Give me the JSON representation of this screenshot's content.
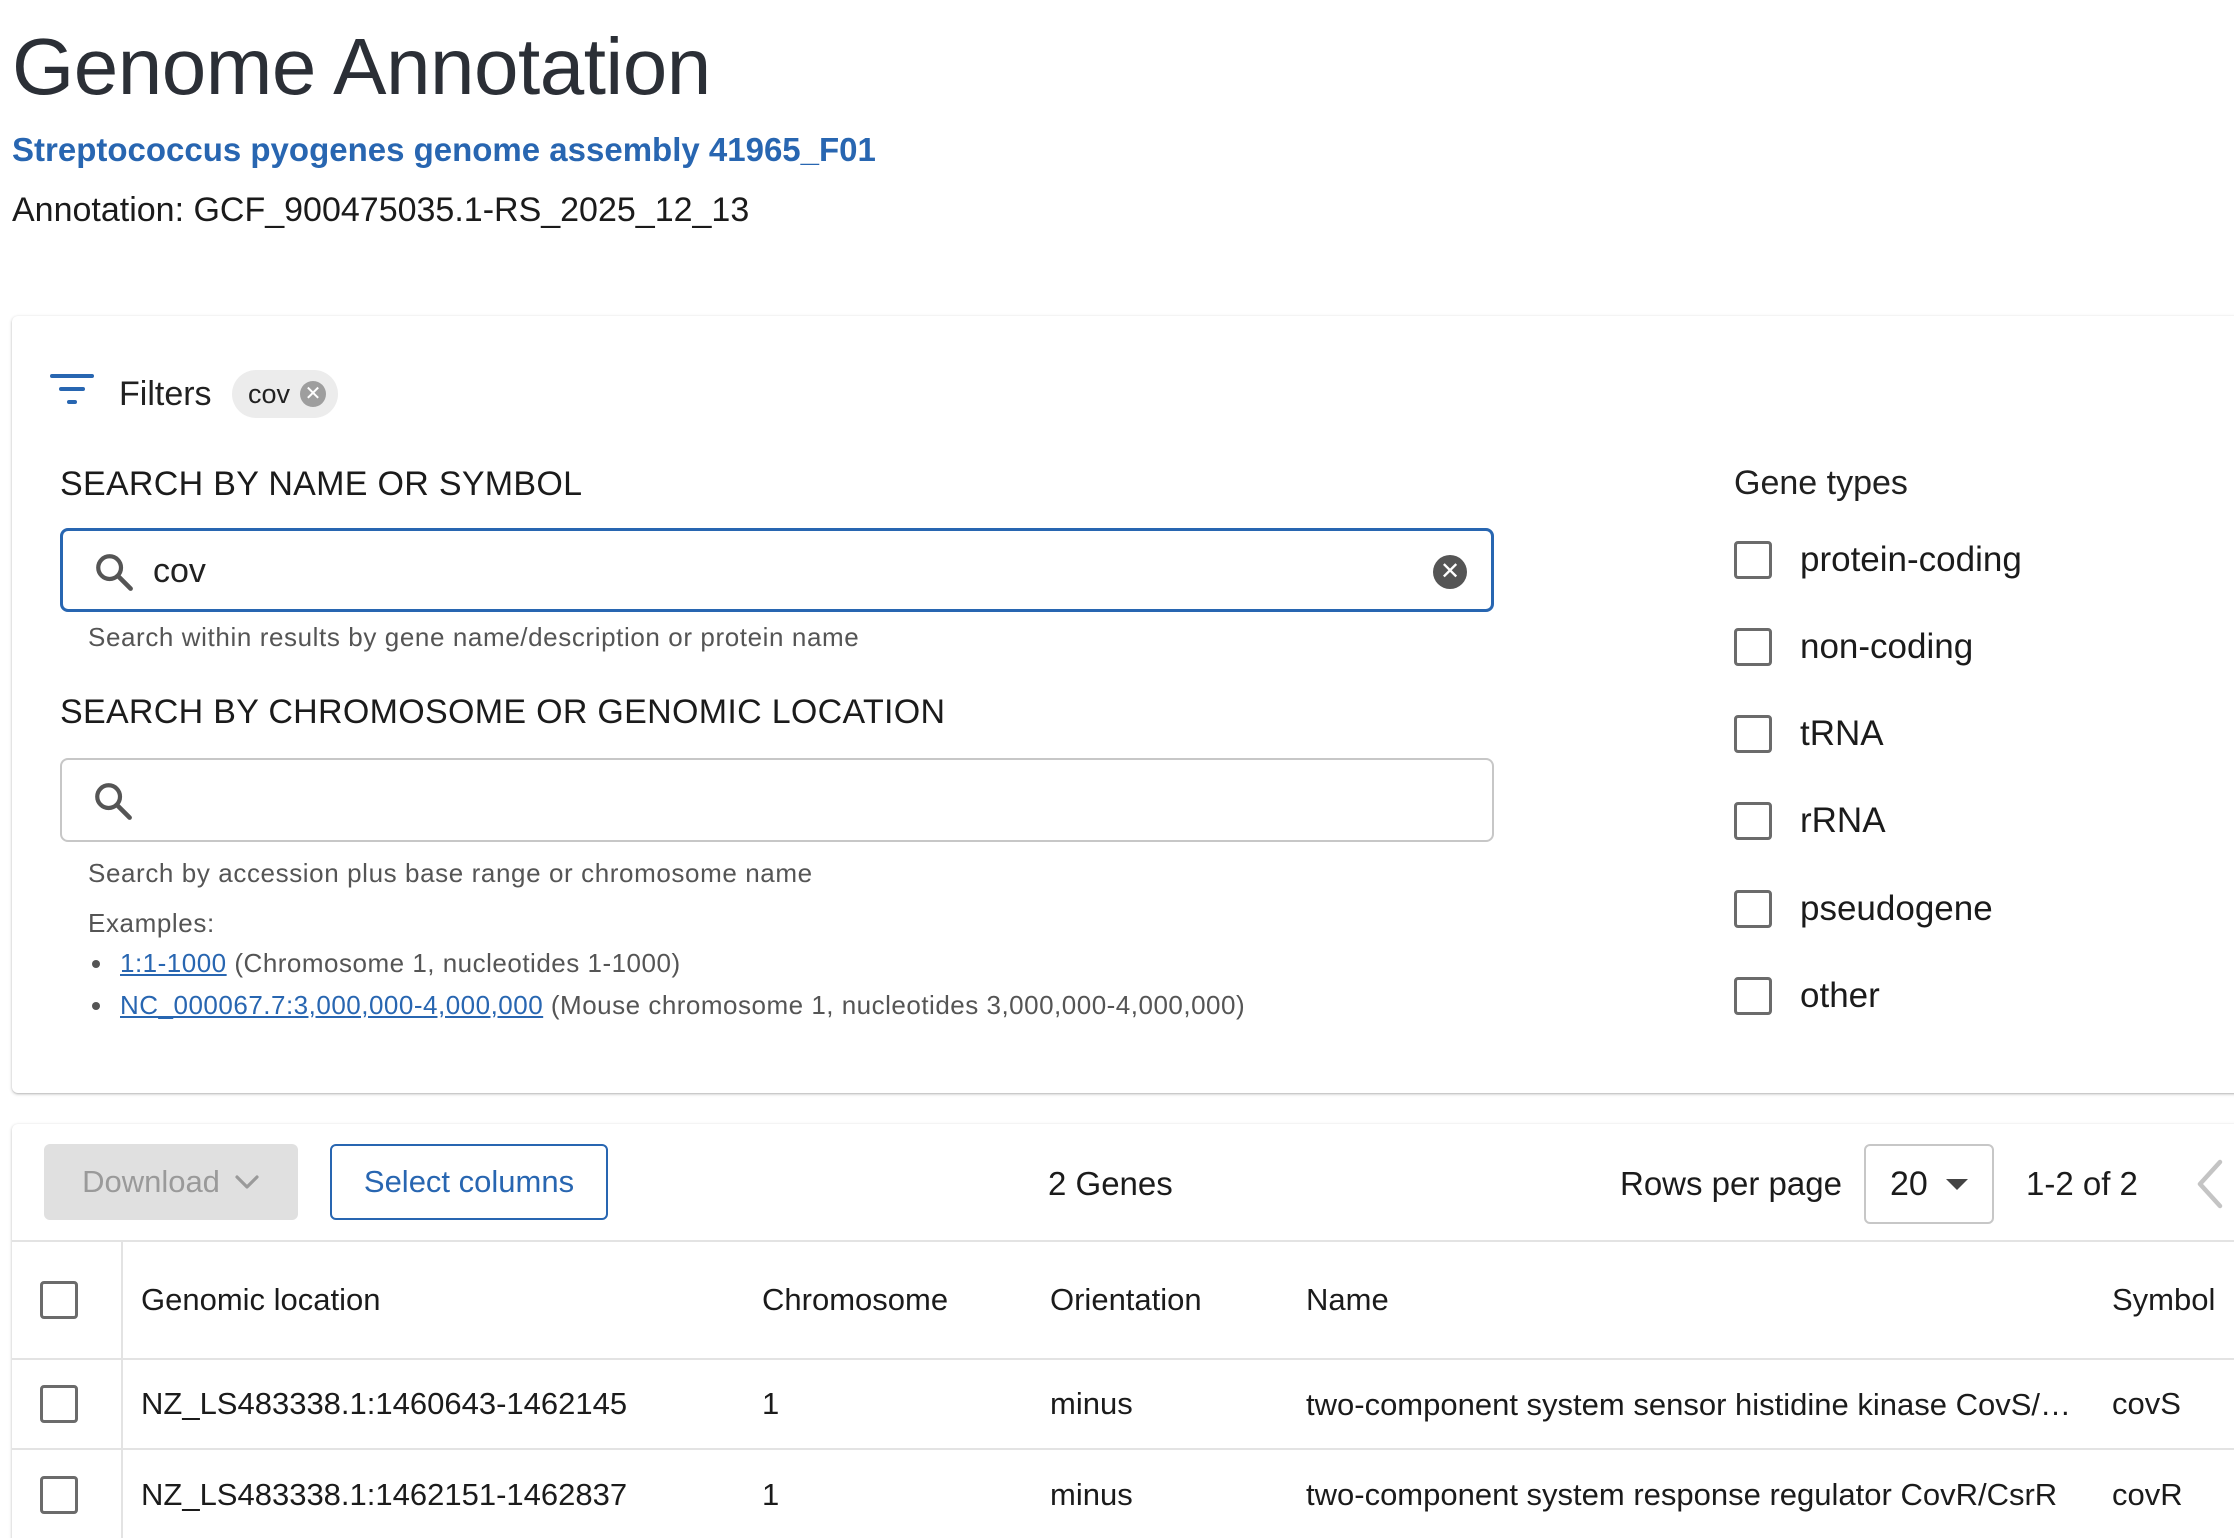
{
  "header": {
    "title": "Genome Annotation",
    "assembly_link": "Streptococcus pyogenes genome assembly 41965_F01",
    "annotation": "Annotation: GCF_900475035.1-RS_2025_12_13"
  },
  "filters": {
    "title": "Filters",
    "chip_label": "cov",
    "name_search": {
      "label": "SEARCH BY NAME OR SYMBOL",
      "value": "cov",
      "helper": "Search within results by gene name/description or protein name"
    },
    "location_search": {
      "label": "SEARCH BY CHROMOSOME OR GENOMIC LOCATION",
      "value": "",
      "helper": "Search by accession plus base range or chromosome name",
      "examples_title": "Examples:",
      "examples": [
        {
          "link": "1:1-1000",
          "desc": " (Chromosome 1, nucleotides 1-1000)"
        },
        {
          "link": "NC_000067.7:3,000,000-4,000,000",
          "desc": " (Mouse chromosome 1, nucleotides 3,000,000-4,000,000)"
        }
      ]
    },
    "gene_types": {
      "title": "Gene types",
      "items": [
        {
          "label": "protein-coding",
          "checked": false
        },
        {
          "label": "non-coding",
          "checked": false
        },
        {
          "label": "tRNA",
          "checked": false
        },
        {
          "label": "rRNA",
          "checked": false
        },
        {
          "label": "pseudogene",
          "checked": false
        },
        {
          "label": "other",
          "checked": false
        }
      ]
    }
  },
  "results": {
    "download_label": "Download",
    "select_columns_label": "Select columns",
    "count_label": "2 Genes",
    "rows_per_page_label": "Rows per page",
    "rows_per_page_value": "20",
    "range_label": "1-2 of 2",
    "columns": [
      "Genomic location",
      "Chromosome",
      "Orientation",
      "Name",
      "Symbol"
    ],
    "rows": [
      {
        "location": "NZ_LS483338.1:1460643-1462145",
        "chromosome": "1",
        "orientation": "minus",
        "name": "two-component system sensor histidine kinase CovS/C...",
        "symbol": "covS"
      },
      {
        "location": "NZ_LS483338.1:1462151-1462837",
        "chromosome": "1",
        "orientation": "minus",
        "name": "two-component system response regulator CovR/CsrR",
        "symbol": "covR"
      }
    ]
  },
  "colors": {
    "accent": "#2866b1",
    "title_text": "#2b2f36",
    "disabled_button": "#e0e0e0"
  },
  "icons": [
    "filter-icon",
    "search-icon",
    "clear-icon",
    "chevron-down-icon",
    "chevron-left-icon"
  ]
}
